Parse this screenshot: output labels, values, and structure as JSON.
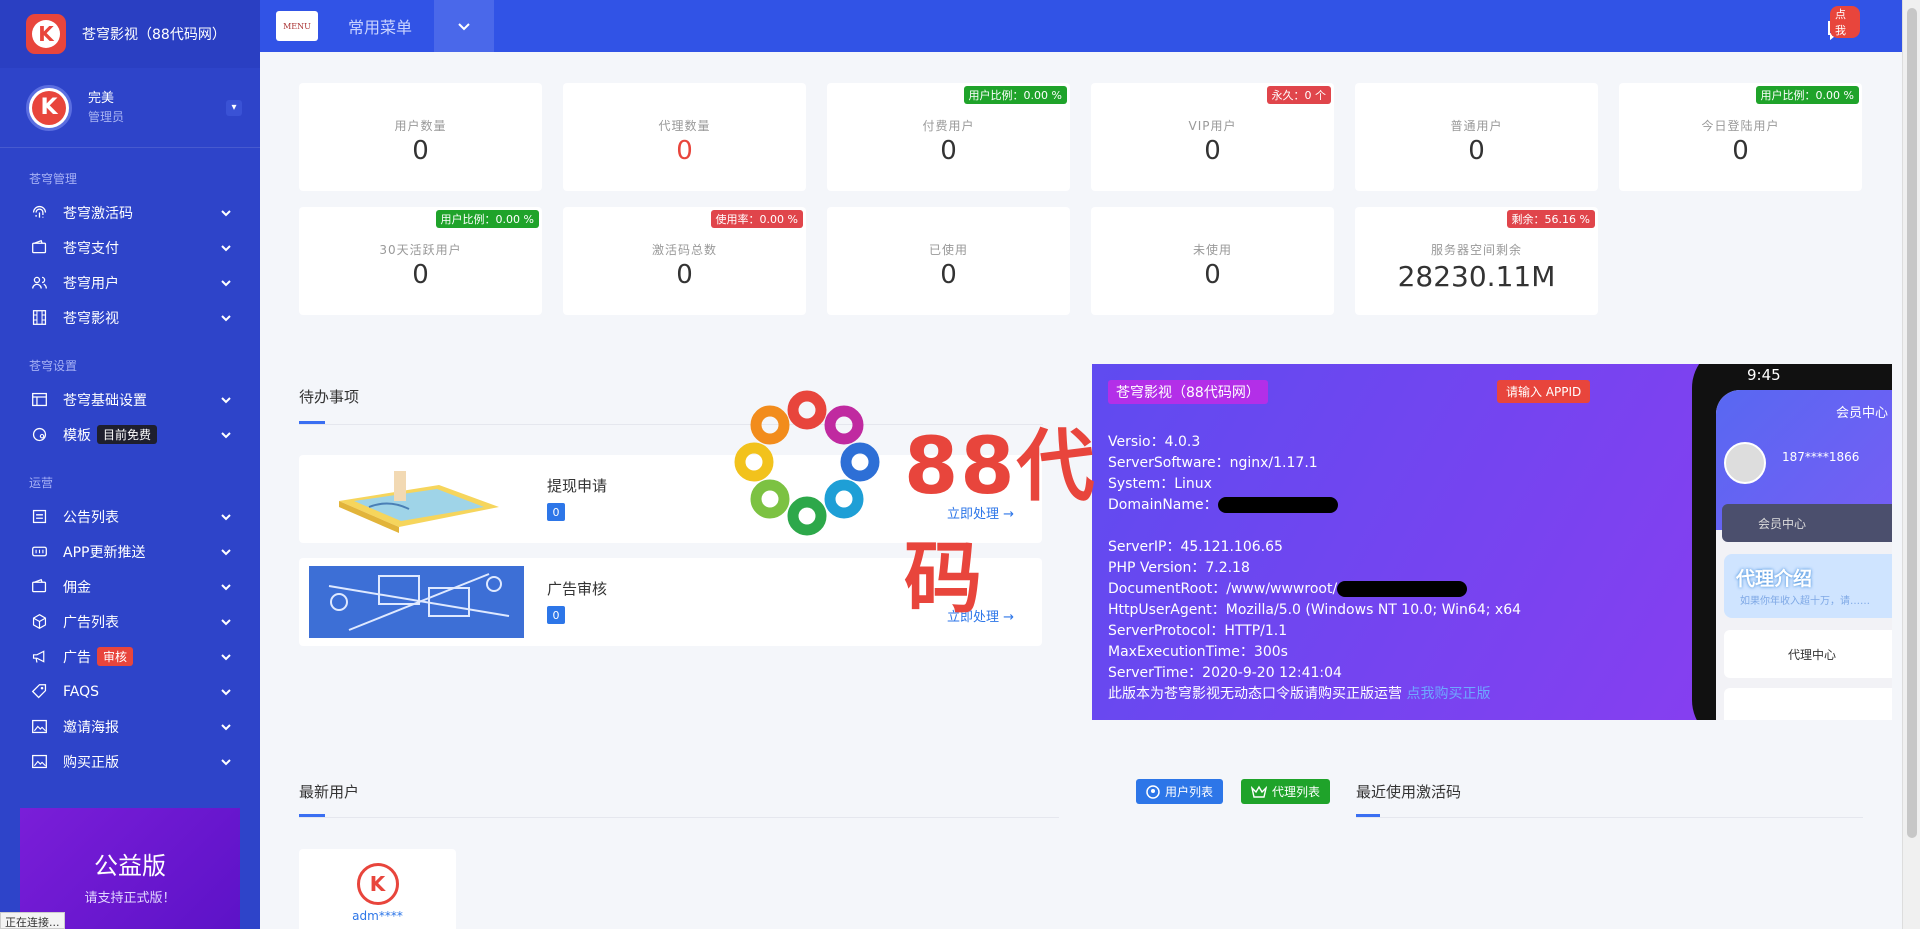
{
  "app": {
    "title": "苍穹影视（88代码网）"
  },
  "user": {
    "name": "完美",
    "role": "管理员"
  },
  "sidebar": {
    "sections": [
      {
        "label": "苍穹管理",
        "items": [
          {
            "label": "苍穹激活码",
            "icon": "fingerprint-icon"
          },
          {
            "label": "苍穹支付",
            "icon": "wallet-icon"
          },
          {
            "label": "苍穹用户",
            "icon": "users-icon"
          },
          {
            "label": "苍穹影视",
            "icon": "film-icon"
          }
        ]
      },
      {
        "label": "苍穹设置",
        "items": [
          {
            "label": "苍穹基础设置",
            "icon": "layout-icon"
          },
          {
            "label": "模板",
            "icon": "palette-icon",
            "tag": "目前免费",
            "tag_color": "#1e1f2e"
          }
        ]
      },
      {
        "label": "运营",
        "items": [
          {
            "label": "公告列表",
            "icon": "notice-icon"
          },
          {
            "label": "APP更新推送",
            "icon": "api-icon"
          },
          {
            "label": "佣金",
            "icon": "wallet-icon"
          },
          {
            "label": "广告列表",
            "icon": "box-icon"
          },
          {
            "label": "广告",
            "icon": "megaphone-icon",
            "tag": "审核",
            "tag_color": "#e8453c"
          },
          {
            "label": "FAQS",
            "icon": "tag-icon"
          },
          {
            "label": "邀请海报",
            "icon": "image-icon"
          },
          {
            "label": "购买正版",
            "icon": "image-icon"
          }
        ]
      }
    ],
    "promo": {
      "title": "公益版",
      "subtitle": "请支持正式版！"
    }
  },
  "topbar": {
    "menu_badge": "MENU",
    "menu_title": "常用菜单",
    "notify_badge": "点我"
  },
  "stats": [
    {
      "label": "用户数量",
      "value": "0",
      "badge": "",
      "badge_color": ""
    },
    {
      "label": "代理数量",
      "value": "0",
      "badge": "",
      "badge_color": "",
      "value_color": "#e8453c"
    },
    {
      "label": "付费用户",
      "value": "0",
      "badge": "用户比例：0.00 %",
      "badge_color": "green"
    },
    {
      "label": "VIP用户",
      "value": "0",
      "badge": "永久：0 个",
      "badge_color": "red"
    },
    {
      "label": "普通用户",
      "value": "0",
      "badge": "",
      "badge_color": ""
    },
    {
      "label": "今日登陆用户",
      "value": "0",
      "badge": "用户比例：0.00 %",
      "badge_color": "green"
    },
    {
      "label": "30天活跃用户",
      "value": "0",
      "badge": "用户比例：0.00 %",
      "badge_color": "green"
    },
    {
      "label": "激活码总数",
      "value": "0",
      "badge": "使用率：0.00 %",
      "badge_color": "red"
    },
    {
      "label": "已使用",
      "value": "0",
      "badge": "",
      "badge_color": ""
    },
    {
      "label": "未使用",
      "value": "0",
      "badge": "",
      "badge_color": ""
    },
    {
      "label": "服务器空间剩余",
      "value": "28230.11M",
      "badge": "剩余：56.16 %",
      "badge_color": "red"
    }
  ],
  "todo": {
    "title": "待办事项",
    "items": [
      {
        "name": "提现申请",
        "count": "0",
        "action": "立即处理 →"
      },
      {
        "name": "广告审核",
        "count": "0",
        "action": "立即处理 →"
      }
    ]
  },
  "info": {
    "title": "苍穹影视（88代码网）",
    "appid_button": "请输入 APPID",
    "version": "Versio：4.0.3",
    "server_software": "ServerSoftware：nginx/1.17.1",
    "system": "System：Linux",
    "domain": "DomainName：",
    "server_ip": "ServerIP：45.121.106.65",
    "php": "PHP Version：7.2.18",
    "docroot": "DocumentRoot：/www/wwwroot/",
    "ua": "HttpUserAgent：Mozilla/5.0 (Windows NT 10.0; Win64; x64",
    "protocol": "ServerProtocol：HTTP/1.1",
    "max_exec": "MaxExecutionTime：300s",
    "server_time": "ServerTime：2020-9-20 12:41:04",
    "footer": "此版本为苍穹影视无动态口令版请购买正版运营",
    "footer_link": "点我购买正版"
  },
  "phone": {
    "time": "9:45",
    "center": "会员中心",
    "phone_no": "187****1866",
    "vip": "会员中心",
    "agent_title": "代理介绍",
    "agent_sub": "如果你年收入超十万，请……",
    "row": "代理中心"
  },
  "bottom": {
    "latest_users": "最新用户",
    "user_list_btn": "用户列表",
    "agent_list_btn": "代理列表",
    "recent_codes": "最近使用激活码",
    "user_name": "adm****"
  },
  "watermark": "88代码",
  "status_text": "正在连接..."
}
